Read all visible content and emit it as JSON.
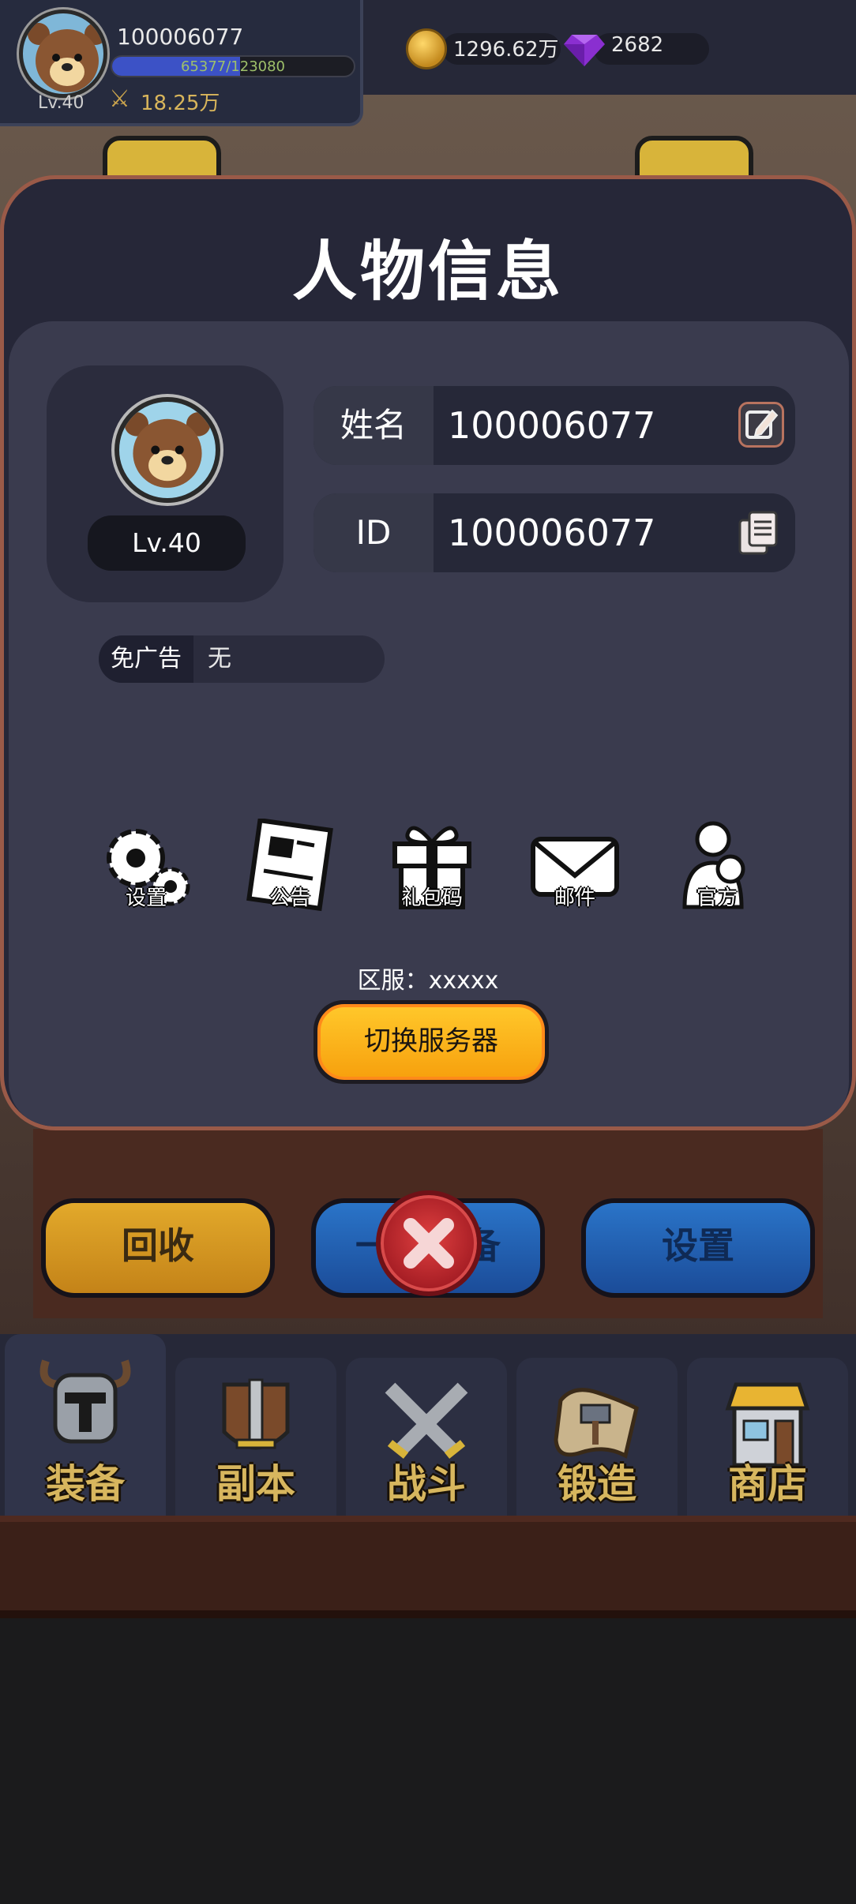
{
  "player": {
    "name": "100006077",
    "level": "Lv.40",
    "exp_text": "65377/123080",
    "exp_progress": 0.531,
    "power": "18.25万"
  },
  "resources": {
    "coins": "1296.62万",
    "gems": "2682"
  },
  "modal": {
    "title": "人物信息",
    "avatar_level": "Lv.40",
    "name_key": "姓名",
    "name_value": "100006077",
    "id_key": "ID",
    "id_value": "100006077",
    "noad_key": "免广告",
    "noad_value": "无",
    "functions": [
      {
        "label": "设置",
        "icon": "gear-icon"
      },
      {
        "label": "公告",
        "icon": "newspaper-icon"
      },
      {
        "label": "礼包码",
        "icon": "gift-icon"
      },
      {
        "label": "邮件",
        "icon": "mail-icon"
      },
      {
        "label": "官方",
        "icon": "people-icon"
      }
    ],
    "server_text": "区服：xxxxx",
    "switch_server": "切换服务器"
  },
  "actions": {
    "recycle": "回收",
    "middle": "一键装备",
    "settings": "设置"
  },
  "tabs": [
    {
      "label": "装备",
      "icon": "helmet-icon"
    },
    {
      "label": "副本",
      "icon": "sword-shield-icon"
    },
    {
      "label": "战斗",
      "icon": "crossed-swords-icon"
    },
    {
      "label": "锻造",
      "icon": "scroll-hammer-icon"
    },
    {
      "label": "商店",
      "icon": "shop-icon"
    }
  ],
  "colors": {
    "modal_bg": "#262738",
    "modal_border": "#9a5a48",
    "accent_yellow": "#ffc72a",
    "tab_label": "#d7b65e"
  }
}
